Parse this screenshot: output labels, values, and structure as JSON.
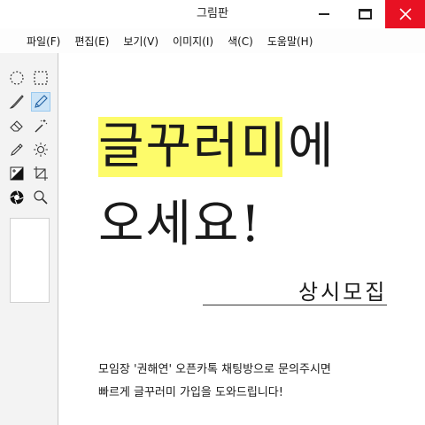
{
  "window": {
    "title": "그림판"
  },
  "menu": {
    "items": [
      "파일(F)",
      "편집(E)",
      "보기(V)",
      "이미지(I)",
      "색(C)",
      "도움말(H)"
    ]
  },
  "tools": [
    {
      "icon": "ellipse-select-icon"
    },
    {
      "icon": "rect-select-icon"
    },
    {
      "icon": "brush-icon"
    },
    {
      "icon": "pencil-icon",
      "active": true
    },
    {
      "icon": "eraser-icon"
    },
    {
      "icon": "magic-wand-icon"
    },
    {
      "icon": "eyedropper-icon"
    },
    {
      "icon": "brightness-icon"
    },
    {
      "icon": "contrast-icon"
    },
    {
      "icon": "crop-icon"
    },
    {
      "icon": "aperture-icon"
    },
    {
      "icon": "zoom-icon"
    }
  ],
  "canvas": {
    "headline_line1": "글꾸러미에",
    "headline_line2": "오세요!",
    "subheading": "상시모집",
    "body_line1": "모임장 '권해연' 오픈카톡 채팅방으로 문의주시면",
    "body_line2": "빠르게 글꾸러미 가입을 도와드립니다!"
  },
  "colors": {
    "close_button": "#e81123",
    "highlight": "#fdfb6a",
    "active_tool": "#cce4f7"
  }
}
